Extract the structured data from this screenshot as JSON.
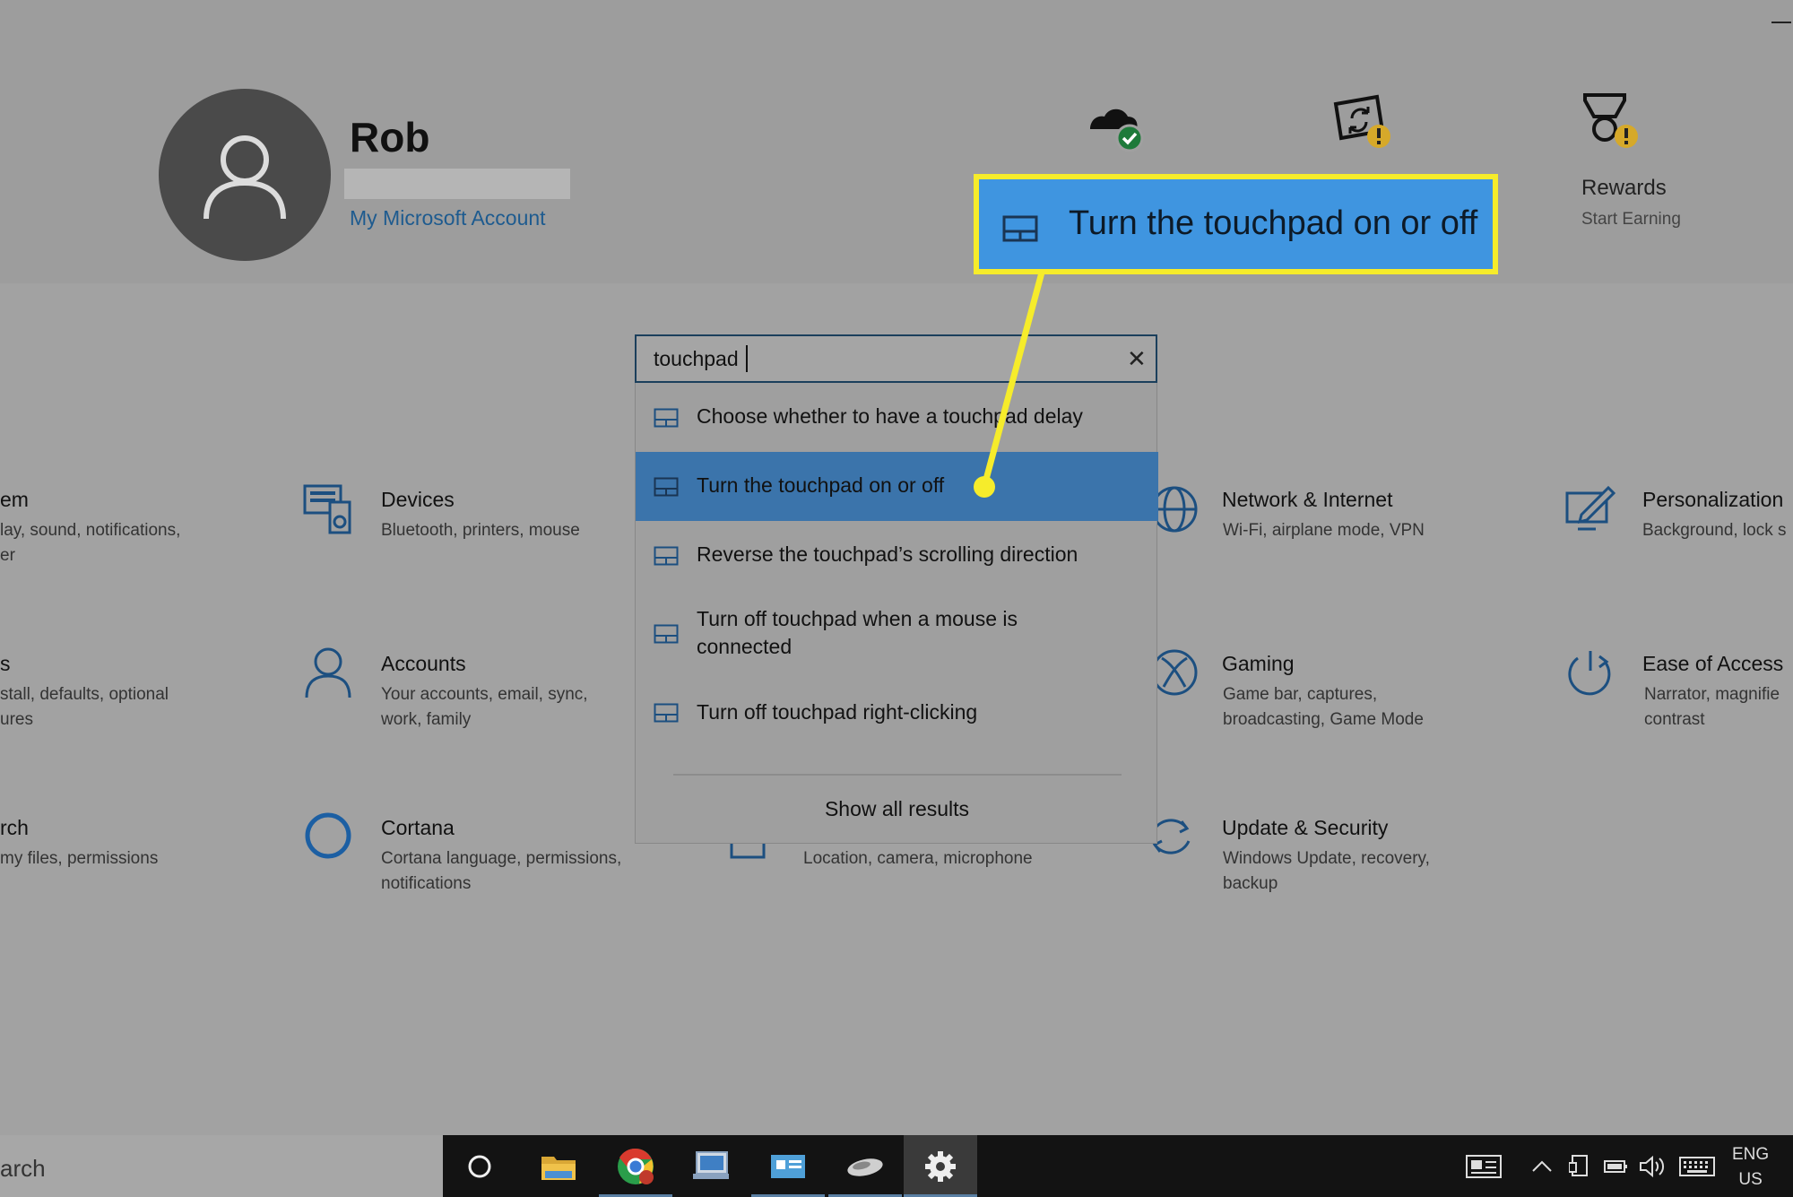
{
  "window": {
    "minimize_icon": "minimize-icon"
  },
  "user": {
    "name": "Rob",
    "account_link": "My Microsoft Account",
    "avatar_icon": "user-avatar-icon"
  },
  "header_icons": {
    "onedrive": "onedrive-cloud-check-icon",
    "sync": "sync-warning-icon",
    "rewards": {
      "icon": "rewards-trophy-warning-icon",
      "label": "Rewards",
      "sub": "Start Earning"
    }
  },
  "callout": {
    "text": "Turn the touchpad on or off",
    "color": "#f6ec2b",
    "bg": "#3f95e0"
  },
  "search": {
    "value": "touchpad",
    "clear_icon": "close-icon"
  },
  "results": [
    {
      "label": "Choose whether to have a touchpad delay",
      "icon": "touchpad-icon",
      "selected": false
    },
    {
      "label": "Turn the touchpad on or off",
      "icon": "touchpad-icon",
      "selected": true
    },
    {
      "label": "Reverse the touchpad’s scrolling direction",
      "icon": "touchpad-icon",
      "selected": false
    },
    {
      "label": "Turn off touchpad when a mouse is connected",
      "icon": "touchpad-icon",
      "selected": false
    },
    {
      "label": "Turn off touchpad right-clicking",
      "icon": "touchpad-icon",
      "selected": false
    }
  ],
  "show_all": "Show all results",
  "tiles": {
    "system": {
      "title": "em",
      "desc1": "lay, sound, notifications,",
      "desc2": "er"
    },
    "devices": {
      "title": "Devices",
      "desc1": "Bluetooth, printers, mouse",
      "icon": "devices-icon"
    },
    "network": {
      "title": "Network & Internet",
      "desc1": "Wi-Fi, airplane mode, VPN",
      "icon": "globe-icon"
    },
    "personalization": {
      "title": "Personalization",
      "desc1": "Background, lock s",
      "icon": "personalization-icon"
    },
    "apps": {
      "title": "s",
      "desc1": "stall, defaults, optional",
      "desc2": "ures"
    },
    "accounts": {
      "title": "Accounts",
      "desc1": "Your accounts, email, sync,",
      "desc2": "work, family",
      "icon": "person-icon"
    },
    "gaming": {
      "title": "Gaming",
      "desc1": "Game bar, captures,",
      "desc2": "broadcasting, Game Mode",
      "icon": "xbox-icon"
    },
    "ease": {
      "title": "Ease of Access",
      "desc1": "Narrator, magnifie",
      "desc2": "contrast",
      "icon": "ease-of-access-icon"
    },
    "search": {
      "title": "rch",
      "desc1": "my files, permissions"
    },
    "cortana": {
      "title": "Cortana",
      "desc1": "Cortana language, permissions,",
      "desc2": "notifications",
      "icon": "cortana-icon"
    },
    "privacy": {
      "desc1": "Location, camera, microphone",
      "icon": "privacy-icon"
    },
    "update": {
      "title": "Update & Security",
      "desc1": "Windows Update, recovery,",
      "desc2": "backup",
      "icon": "update-icon"
    }
  },
  "taskbar": {
    "search_text": "arch",
    "apps": [
      "cortana-circle-icon",
      "file-explorer-icon",
      "chrome-icon",
      "pc-app-icon",
      "mail-app-icon",
      "mouse-app-icon",
      "settings-gear-icon"
    ],
    "lang1": "ENG",
    "lang2": "US",
    "tray_icons": [
      "news-icon",
      "chevron-up-icon",
      "tablet-icon",
      "battery-icon",
      "volume-icon",
      "keyboard-icon"
    ]
  }
}
